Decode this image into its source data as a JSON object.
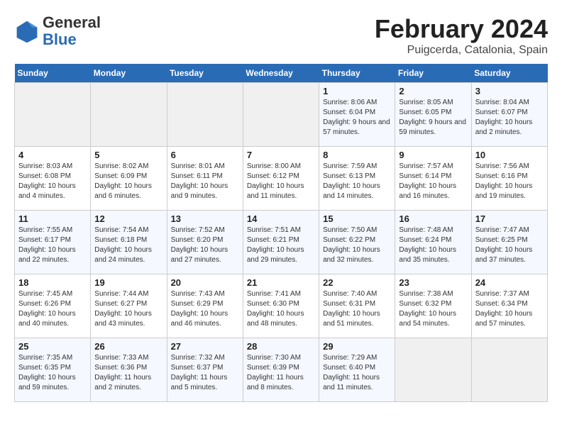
{
  "header": {
    "logo_general": "General",
    "logo_blue": "Blue",
    "title": "February 2024",
    "subtitle": "Puigcerda, Catalonia, Spain"
  },
  "calendar": {
    "weekdays": [
      "Sunday",
      "Monday",
      "Tuesday",
      "Wednesday",
      "Thursday",
      "Friday",
      "Saturday"
    ],
    "weeks": [
      [
        {
          "day": "",
          "info": ""
        },
        {
          "day": "",
          "info": ""
        },
        {
          "day": "",
          "info": ""
        },
        {
          "day": "",
          "info": ""
        },
        {
          "day": "1",
          "info": "Sunrise: 8:06 AM\nSunset: 6:04 PM\nDaylight: 9 hours and 57 minutes."
        },
        {
          "day": "2",
          "info": "Sunrise: 8:05 AM\nSunset: 6:05 PM\nDaylight: 9 hours and 59 minutes."
        },
        {
          "day": "3",
          "info": "Sunrise: 8:04 AM\nSunset: 6:07 PM\nDaylight: 10 hours and 2 minutes."
        }
      ],
      [
        {
          "day": "4",
          "info": "Sunrise: 8:03 AM\nSunset: 6:08 PM\nDaylight: 10 hours and 4 minutes."
        },
        {
          "day": "5",
          "info": "Sunrise: 8:02 AM\nSunset: 6:09 PM\nDaylight: 10 hours and 6 minutes."
        },
        {
          "day": "6",
          "info": "Sunrise: 8:01 AM\nSunset: 6:11 PM\nDaylight: 10 hours and 9 minutes."
        },
        {
          "day": "7",
          "info": "Sunrise: 8:00 AM\nSunset: 6:12 PM\nDaylight: 10 hours and 11 minutes."
        },
        {
          "day": "8",
          "info": "Sunrise: 7:59 AM\nSunset: 6:13 PM\nDaylight: 10 hours and 14 minutes."
        },
        {
          "day": "9",
          "info": "Sunrise: 7:57 AM\nSunset: 6:14 PM\nDaylight: 10 hours and 16 minutes."
        },
        {
          "day": "10",
          "info": "Sunrise: 7:56 AM\nSunset: 6:16 PM\nDaylight: 10 hours and 19 minutes."
        }
      ],
      [
        {
          "day": "11",
          "info": "Sunrise: 7:55 AM\nSunset: 6:17 PM\nDaylight: 10 hours and 22 minutes."
        },
        {
          "day": "12",
          "info": "Sunrise: 7:54 AM\nSunset: 6:18 PM\nDaylight: 10 hours and 24 minutes."
        },
        {
          "day": "13",
          "info": "Sunrise: 7:52 AM\nSunset: 6:20 PM\nDaylight: 10 hours and 27 minutes."
        },
        {
          "day": "14",
          "info": "Sunrise: 7:51 AM\nSunset: 6:21 PM\nDaylight: 10 hours and 29 minutes."
        },
        {
          "day": "15",
          "info": "Sunrise: 7:50 AM\nSunset: 6:22 PM\nDaylight: 10 hours and 32 minutes."
        },
        {
          "day": "16",
          "info": "Sunrise: 7:48 AM\nSunset: 6:24 PM\nDaylight: 10 hours and 35 minutes."
        },
        {
          "day": "17",
          "info": "Sunrise: 7:47 AM\nSunset: 6:25 PM\nDaylight: 10 hours and 37 minutes."
        }
      ],
      [
        {
          "day": "18",
          "info": "Sunrise: 7:45 AM\nSunset: 6:26 PM\nDaylight: 10 hours and 40 minutes."
        },
        {
          "day": "19",
          "info": "Sunrise: 7:44 AM\nSunset: 6:27 PM\nDaylight: 10 hours and 43 minutes."
        },
        {
          "day": "20",
          "info": "Sunrise: 7:43 AM\nSunset: 6:29 PM\nDaylight: 10 hours and 46 minutes."
        },
        {
          "day": "21",
          "info": "Sunrise: 7:41 AM\nSunset: 6:30 PM\nDaylight: 10 hours and 48 minutes."
        },
        {
          "day": "22",
          "info": "Sunrise: 7:40 AM\nSunset: 6:31 PM\nDaylight: 10 hours and 51 minutes."
        },
        {
          "day": "23",
          "info": "Sunrise: 7:38 AM\nSunset: 6:32 PM\nDaylight: 10 hours and 54 minutes."
        },
        {
          "day": "24",
          "info": "Sunrise: 7:37 AM\nSunset: 6:34 PM\nDaylight: 10 hours and 57 minutes."
        }
      ],
      [
        {
          "day": "25",
          "info": "Sunrise: 7:35 AM\nSunset: 6:35 PM\nDaylight: 10 hours and 59 minutes."
        },
        {
          "day": "26",
          "info": "Sunrise: 7:33 AM\nSunset: 6:36 PM\nDaylight: 11 hours and 2 minutes."
        },
        {
          "day": "27",
          "info": "Sunrise: 7:32 AM\nSunset: 6:37 PM\nDaylight: 11 hours and 5 minutes."
        },
        {
          "day": "28",
          "info": "Sunrise: 7:30 AM\nSunset: 6:39 PM\nDaylight: 11 hours and 8 minutes."
        },
        {
          "day": "29",
          "info": "Sunrise: 7:29 AM\nSunset: 6:40 PM\nDaylight: 11 hours and 11 minutes."
        },
        {
          "day": "",
          "info": ""
        },
        {
          "day": "",
          "info": ""
        }
      ]
    ]
  }
}
